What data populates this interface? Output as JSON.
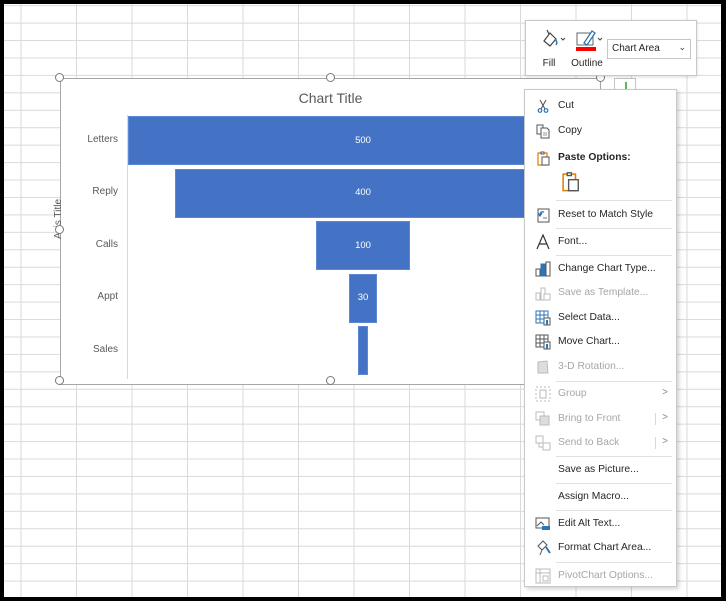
{
  "chart_data": {
    "type": "bar",
    "subtype": "funnel",
    "title": "Chart Title",
    "xlabel": "",
    "ylabel": "Axis Title",
    "categories": [
      "Letters",
      "Reply",
      "Calls",
      "Appt",
      "Sales"
    ],
    "values": [
      500,
      400,
      100,
      30,
      10
    ],
    "data_labels": [
      "500",
      "400",
      "100",
      "30",
      ""
    ],
    "bar_color": "#4472c4",
    "grid": false,
    "legend": "none"
  },
  "mini_toolbar": {
    "fill_label": "Fill",
    "outline_label": "Outline",
    "outline_color": "#ff0000",
    "element_select": "Chart Area"
  },
  "context_menu": {
    "items": [
      {
        "label": "Cut",
        "icon": "scissors-icon",
        "enabled": true
      },
      {
        "label": "Copy",
        "icon": "copy-icon",
        "enabled": true
      },
      {
        "label": "Paste Options:",
        "icon": "paste-icon",
        "enabled": true,
        "header": true
      },
      {
        "label": "Reset to Match Style",
        "icon": "reset-style-icon",
        "enabled": true
      },
      {
        "label": "Font...",
        "icon": "font-icon",
        "enabled": true
      },
      {
        "label": "Change Chart Type...",
        "icon": "chart-type-icon",
        "enabled": true
      },
      {
        "label": "Save as Template...",
        "icon": "template-icon",
        "enabled": false
      },
      {
        "label": "Select Data...",
        "icon": "select-data-icon",
        "enabled": true
      },
      {
        "label": "Move Chart...",
        "icon": "move-chart-icon",
        "enabled": true
      },
      {
        "label": "3-D Rotation...",
        "icon": "rotation-icon",
        "enabled": false
      },
      {
        "label": "Group",
        "icon": "group-icon",
        "enabled": false,
        "submenu": true
      },
      {
        "label": "Bring to Front",
        "icon": "bring-front-icon",
        "enabled": false,
        "submenu": true
      },
      {
        "label": "Send to Back",
        "icon": "send-back-icon",
        "enabled": false,
        "submenu": true
      },
      {
        "label": "Save as Picture...",
        "icon": "",
        "enabled": true
      },
      {
        "label": "Assign Macro...",
        "icon": "",
        "enabled": true
      },
      {
        "label": "Edit Alt Text...",
        "icon": "alt-text-icon",
        "enabled": true
      },
      {
        "label": "Format Chart Area...",
        "icon": "format-icon",
        "enabled": true
      },
      {
        "label": "PivotChart Options...",
        "icon": "pivot-icon",
        "enabled": false
      }
    ]
  }
}
